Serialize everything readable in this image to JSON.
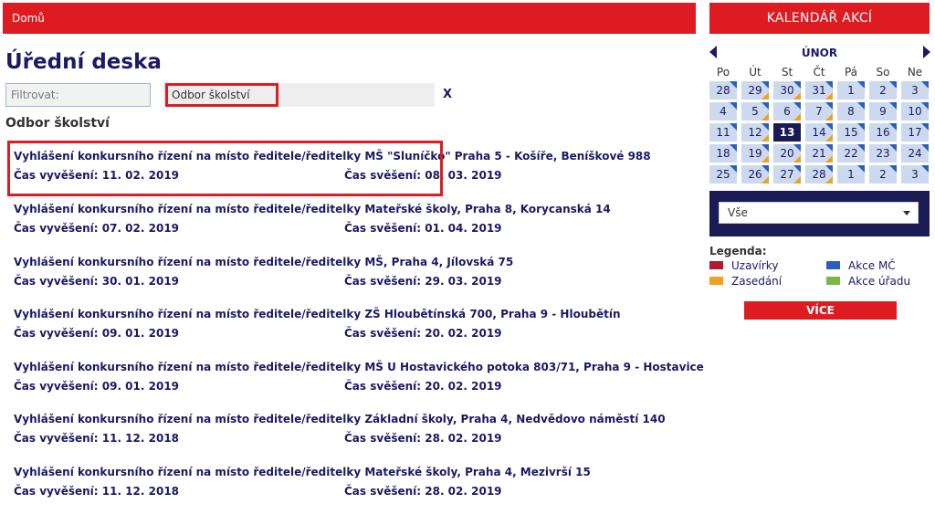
{
  "breadcrumb": {
    "home_label": "Domů"
  },
  "page": {
    "title": "Úřední deska"
  },
  "filter": {
    "label_placeholder": "Filtrovat:",
    "selected_department": "Odbor školství",
    "clear_label": "X"
  },
  "section": {
    "heading": "Odbor školství"
  },
  "notices": [
    {
      "title": "Vyhlášení konkursního řízení na místo ředitele/ředitelky MŠ \"Sluníčko\" Praha 5 - Košíře, Beníškové 988",
      "posted": "Čas vyvěšení: 11. 02. 2019",
      "removed": "Čas svěšení: 08. 03. 2019"
    },
    {
      "title": "Vyhlášení konkursního řízení na místo ředitele/ředitelky Mateřské školy, Praha 8, Korycanská 14",
      "posted": "Čas vyvěšení: 07. 02. 2019",
      "removed": "Čas svěšení: 01. 04. 2019"
    },
    {
      "title": "Vyhlášení konkursního řízení na místo ředitele/ředitelky MŠ, Praha 4, Jílovská 75",
      "posted": "Čas vyvěšení: 30. 01. 2019",
      "removed": "Čas svěšení: 29. 03. 2019"
    },
    {
      "title": "Vyhlášení konkursního řízení na místo ředitele/ředitelky ZŠ Hloubětínská 700, Praha 9 - Hloubětín",
      "posted": "Čas vyvěšení: 09. 01. 2019",
      "removed": "Čas svěšení: 20. 02. 2019"
    },
    {
      "title": "Vyhlášení konkursního řízení na místo ředitele/ředitelky MŠ U Hostavického potoka 803/71, Praha 9 - Hostavice",
      "posted": "Čas vyvěšení: 09. 01. 2019",
      "removed": "Čas svěšení: 20. 02. 2019"
    },
    {
      "title": "Vyhlášení konkursního řízení na místo ředitele/ředitelky Základní školy, Praha 4, Nedvědovo náměstí 140",
      "posted": "Čas vyvěšení: 11. 12. 2018",
      "removed": "Čas svěšení: 28. 02. 2019"
    },
    {
      "title": "Vyhlášení konkursního řízení na místo ředitele/ředitelky Mateřské školy, Praha 4, Mezivrší 15",
      "posted": "Čas vyvěšení: 11. 12. 2018",
      "removed": "Čas svěšení: 28. 02. 2019"
    }
  ],
  "calendar": {
    "header": "KALENDÁŘ AKCÍ",
    "month": "ÚNOR",
    "weekdays": [
      "Po",
      "Út",
      "St",
      "Čt",
      "Pá",
      "So",
      "Ne"
    ],
    "weeks": [
      [
        {
          "d": "28",
          "out": true,
          "m": [
            "blue"
          ]
        },
        {
          "d": "29",
          "out": true,
          "m": [
            "blue",
            "orange"
          ]
        },
        {
          "d": "30",
          "out": true,
          "m": [
            "blue",
            "orange"
          ]
        },
        {
          "d": "31",
          "out": true,
          "m": [
            "blue",
            "orange"
          ]
        },
        {
          "d": "1",
          "m": [
            "blue"
          ]
        },
        {
          "d": "2",
          "m": [
            "blue"
          ]
        },
        {
          "d": "3",
          "m": [
            "blue"
          ]
        }
      ],
      [
        {
          "d": "4",
          "m": [
            "blue"
          ]
        },
        {
          "d": "5",
          "m": [
            "blue",
            "orange"
          ]
        },
        {
          "d": "6",
          "m": [
            "blue",
            "orange"
          ]
        },
        {
          "d": "7",
          "m": [
            "blue",
            "orange"
          ]
        },
        {
          "d": "8",
          "m": [
            "blue"
          ]
        },
        {
          "d": "9",
          "m": [
            "blue"
          ]
        },
        {
          "d": "10",
          "m": [
            "blue"
          ]
        }
      ],
      [
        {
          "d": "11",
          "m": [
            "blue"
          ]
        },
        {
          "d": "12",
          "m": [
            "blue",
            "orange"
          ]
        },
        {
          "d": "13",
          "today": true,
          "m": []
        },
        {
          "d": "14",
          "m": [
            "blue",
            "orange"
          ]
        },
        {
          "d": "15",
          "m": [
            "blue"
          ]
        },
        {
          "d": "16",
          "m": [
            "blue"
          ]
        },
        {
          "d": "17",
          "m": [
            "blue"
          ]
        }
      ],
      [
        {
          "d": "18",
          "m": [
            "blue"
          ]
        },
        {
          "d": "19",
          "m": [
            "blue",
            "orange"
          ]
        },
        {
          "d": "20",
          "m": [
            "blue",
            "orange"
          ]
        },
        {
          "d": "21",
          "m": [
            "blue",
            "orange"
          ]
        },
        {
          "d": "22",
          "m": [
            "blue"
          ]
        },
        {
          "d": "23",
          "m": [
            "blue"
          ]
        },
        {
          "d": "24",
          "m": [
            "blue"
          ]
        }
      ],
      [
        {
          "d": "25",
          "m": [
            "blue"
          ]
        },
        {
          "d": "26",
          "m": [
            "blue",
            "orange"
          ]
        },
        {
          "d": "27",
          "m": [
            "blue",
            "orange"
          ]
        },
        {
          "d": "28",
          "m": [
            "blue",
            "orange"
          ]
        },
        {
          "d": "1",
          "out": true,
          "m": [
            "blue"
          ]
        },
        {
          "d": "2",
          "out": true,
          "m": [
            "blue"
          ]
        },
        {
          "d": "3",
          "out": true,
          "m": [
            "blue"
          ]
        }
      ]
    ],
    "type_filter": "Vše"
  },
  "legend": {
    "title": "Legenda:",
    "items": [
      {
        "label": "Uzavírky",
        "color": "#b01c2e"
      },
      {
        "label": "Akce MČ",
        "color": "#2a5fbf"
      },
      {
        "label": "Zasedání",
        "color": "#f0a11f"
      },
      {
        "label": "Akce úřadu",
        "color": "#7ab648"
      }
    ]
  },
  "more_button": "VÍCE",
  "colors": {
    "accent_red": "#df1b22",
    "navy": "#1a1a55",
    "day_cell": "#cdd9ee"
  }
}
